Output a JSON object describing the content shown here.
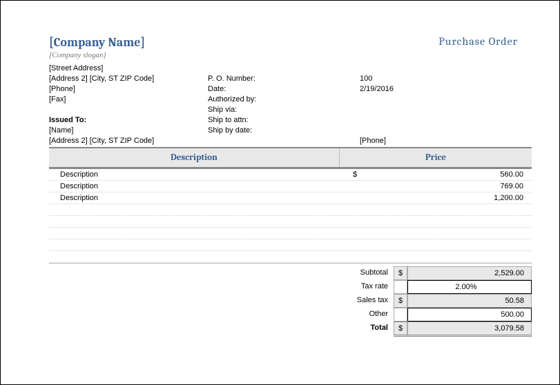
{
  "header": {
    "company_name": "[Company Name]",
    "doc_title": "Purchase Order",
    "slogan": "[Company slogan]"
  },
  "company": {
    "street": "[Street Address]",
    "address2": "[Address 2] [City, ST ZIP Code]",
    "phone": "[Phone]",
    "fax": "[Fax]"
  },
  "po": {
    "po_number_label": "P. O. Number:",
    "po_number": "100",
    "date_label": "Date:",
    "date": "2/19/2016",
    "authorized_label": "Authorized by:",
    "authorized": "",
    "shipvia_label": "Ship via:",
    "shipvia": "",
    "shipattn_label": "Ship to attn:",
    "shipattn": "",
    "shipby_label": "Ship by date:",
    "shipby": ""
  },
  "issued": {
    "label": "Issued To:",
    "name": "[Name]",
    "address": "[Address 2] [City, ST ZIP Code]",
    "phone": "[Phone]"
  },
  "table": {
    "head_desc": "Description",
    "head_price": "Price",
    "currency": "$",
    "rows": [
      {
        "desc": "Description",
        "price": "560.00"
      },
      {
        "desc": "Description",
        "price": "769.00"
      },
      {
        "desc": "Description",
        "price": "1,200.00"
      },
      {
        "desc": "",
        "price": ""
      },
      {
        "desc": "",
        "price": ""
      },
      {
        "desc": "",
        "price": ""
      },
      {
        "desc": "",
        "price": ""
      },
      {
        "desc": "",
        "price": ""
      }
    ]
  },
  "totals": {
    "subtotal_label": "Subtotal",
    "subtotal": "2,529.00",
    "taxrate_label": "Tax rate",
    "taxrate": "2.00%",
    "salestax_label": "Sales tax",
    "salestax": "50.58",
    "other_label": "Other",
    "other": "500.00",
    "total_label": "Total",
    "total": "3,079.58",
    "currency": "$"
  }
}
